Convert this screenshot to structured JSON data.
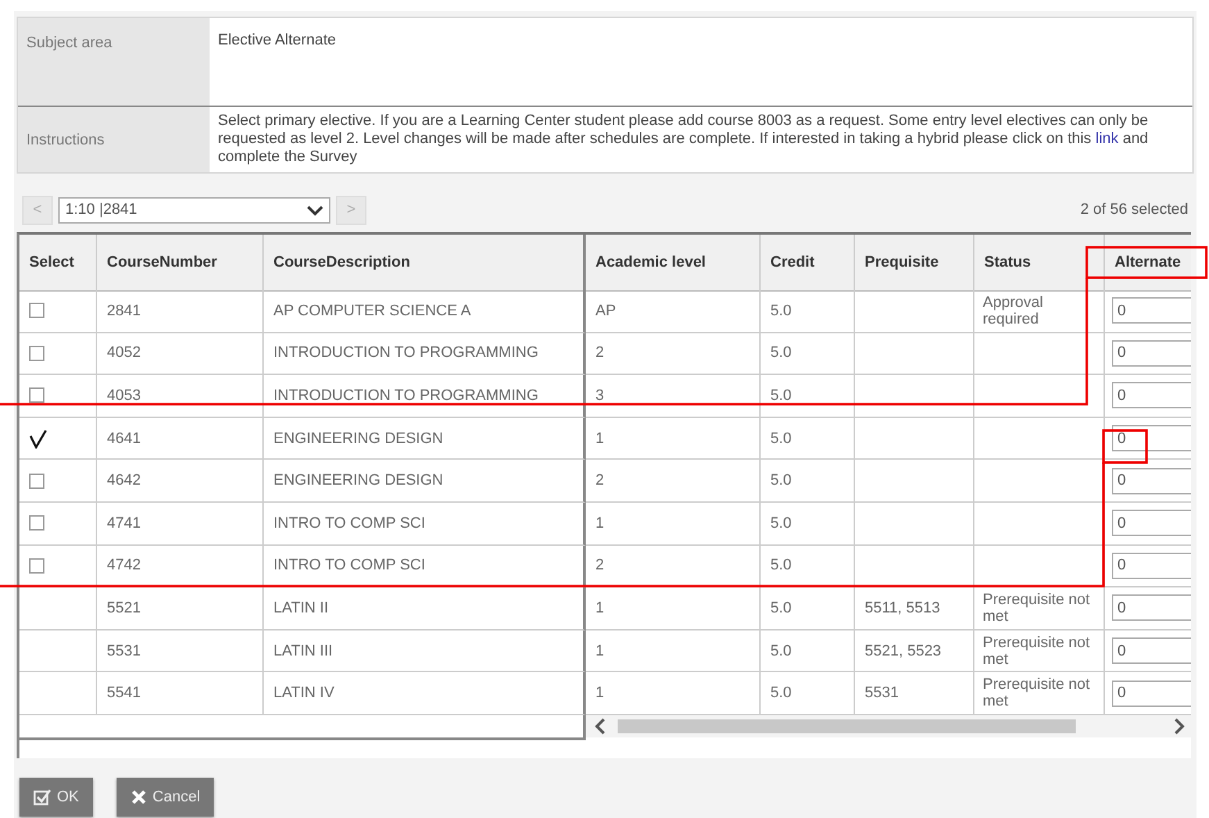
{
  "info": {
    "subject_label": "Subject area",
    "subject_value": "Elective Alternate",
    "instructions_label": "Instructions",
    "instructions_before": "Select primary elective. If you are a Learning Center student please add course 8003 as a request. Some entry level electives can only be requested as level 2.  Level changes will be made after schedules are complete. If interested in taking a hybrid please click on this",
    "instructions_link": "link",
    "instructions_after": "and complete the Survey"
  },
  "pager": {
    "prev": "<",
    "range": "1:10 |2841",
    "next": ">",
    "selected_count": "2 of 56 selected"
  },
  "table": {
    "columns": [
      "Select",
      "CourseNumber",
      "CourseDescription",
      "Academic level",
      "Credit",
      "Prequisite",
      "Status",
      "Alternate"
    ],
    "rows": [
      {
        "kind": "checkbox",
        "checked": false,
        "number": "2841",
        "description": "AP COMPUTER SCIENCE A",
        "level": "AP",
        "credit": "5.0",
        "prerequisite": "",
        "status": "Approval required",
        "alternate": "0"
      },
      {
        "kind": "checkbox",
        "checked": false,
        "number": "4052",
        "description": "INTRODUCTION TO PROGRAMMING",
        "level": "2",
        "credit": "5.0",
        "prerequisite": "",
        "status": "",
        "alternate": "0"
      },
      {
        "kind": "checkbox",
        "checked": false,
        "number": "4053",
        "description": "INTRODUCTION TO PROGRAMMING",
        "level": "3",
        "credit": "5.0",
        "prerequisite": "",
        "status": "",
        "alternate": "0"
      },
      {
        "kind": "checkbox",
        "checked": true,
        "number": "4641",
        "description": "ENGINEERING DESIGN",
        "level": "1",
        "credit": "5.0",
        "prerequisite": "",
        "status": "",
        "alternate": "0"
      },
      {
        "kind": "checkbox",
        "checked": false,
        "number": "4642",
        "description": "ENGINEERING DESIGN",
        "level": "2",
        "credit": "5.0",
        "prerequisite": "",
        "status": "",
        "alternate": "0"
      },
      {
        "kind": "checkbox",
        "checked": false,
        "number": "4741",
        "description": "INTRO TO COMP SCI",
        "level": "1",
        "credit": "5.0",
        "prerequisite": "",
        "status": "",
        "alternate": "0"
      },
      {
        "kind": "checkbox",
        "checked": false,
        "number": "4742",
        "description": "INTRO TO COMP SCI",
        "level": "2",
        "credit": "5.0",
        "prerequisite": "",
        "status": "",
        "alternate": "0"
      },
      {
        "kind": "locked",
        "number": "5521",
        "description": "LATIN II",
        "level": "1",
        "credit": "5.0",
        "prerequisite": "5511, 5513",
        "status": "Prerequisite not met",
        "alternate": "0"
      },
      {
        "kind": "locked",
        "number": "5531",
        "description": "LATIN III",
        "level": "1",
        "credit": "5.0",
        "prerequisite": "5521, 5523",
        "status": "Prerequisite not met",
        "alternate": "0"
      },
      {
        "kind": "locked",
        "number": "5541",
        "description": "LATIN IV",
        "level": "1",
        "credit": "5.0",
        "prerequisite": "5531",
        "status": "Prerequisite not met",
        "alternate": "0"
      }
    ]
  },
  "buttons": [
    {
      "kind": "ok",
      "label": "OK"
    },
    {
      "kind": "cancel",
      "label": "Cancel"
    }
  ]
}
